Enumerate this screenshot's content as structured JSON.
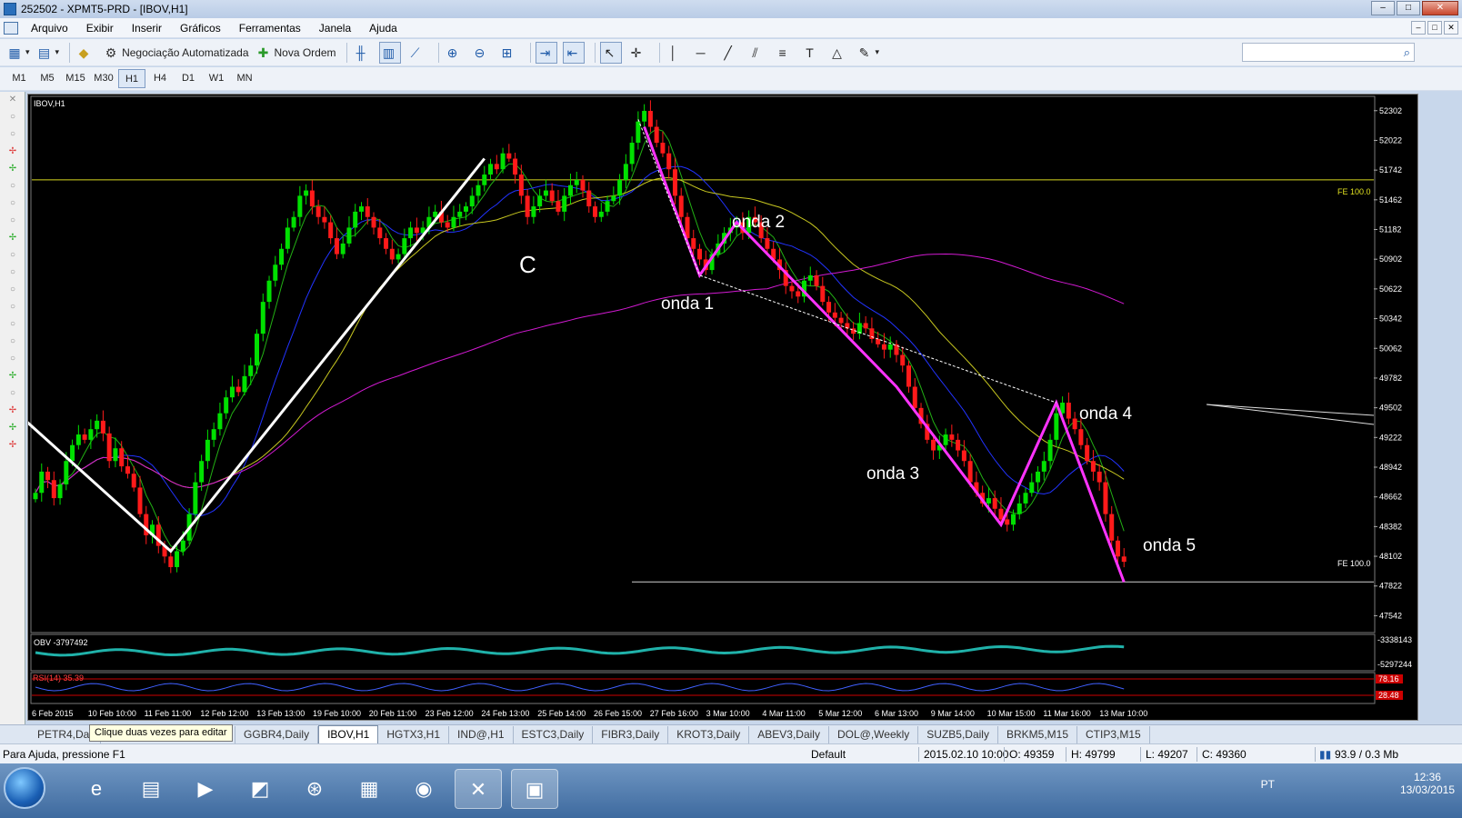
{
  "window": {
    "title": "252502 - XPMT5-PRD - [IBOV,H1]",
    "controls": [
      "–",
      "□",
      "✕"
    ]
  },
  "menu": {
    "items": [
      "Arquivo",
      "Exibir",
      "Inserir",
      "Gráficos",
      "Ferramentas",
      "Janela",
      "Ajuda"
    ]
  },
  "toolbar": {
    "auto_trading_label": "Negociação Automatizada",
    "new_order_label": "Nova Ordem",
    "search_placeholder": ""
  },
  "timeframes": {
    "items": [
      "M1",
      "M5",
      "M15",
      "M30",
      "H1",
      "H4",
      "D1",
      "W1",
      "MN"
    ],
    "active": "H1"
  },
  "chart": {
    "symbol_label": "IBOV,H1",
    "obv_label": "OBV -3797492",
    "rsi_label": "RSI(14) 35.39",
    "fe_label_top": "FE 100.0",
    "fe_label_bottom": "FE 100.0",
    "obv_scale": [
      "-3338143",
      "-5297244"
    ],
    "rsi_scale": [
      "78.16",
      "28.48"
    ],
    "wave_labels": [
      "C",
      "onda 1",
      "onda 2",
      "onda 3",
      "onda 4",
      "onda 5"
    ],
    "colors": {
      "bull": "#00e000",
      "bear": "#ff1a1a",
      "ma_fast": "#22b014",
      "ma_mid": "#2233ff",
      "ma_slow": "#c8c820",
      "ma_long": "#d21ad2",
      "wave_line": "#ff33ff",
      "impulse_line": "#ffffff",
      "obv_line": "#20b2aa"
    }
  },
  "chart_data": {
    "type": "candlestick",
    "title": "IBOV,H1",
    "y_ticks": [
      52302,
      52022,
      51742,
      51462,
      51182,
      50902,
      50622,
      50342,
      50062,
      49782,
      49502,
      49222,
      48942,
      48662,
      48382,
      48102,
      47822,
      47542
    ],
    "x_ticks": [
      "6 Feb 2015",
      "10 Feb 10:00",
      "11 Feb 11:00",
      "12 Feb 12:00",
      "13 Feb 13:00",
      "19 Feb 10:00",
      "20 Feb 11:00",
      "23 Feb 12:00",
      "24 Feb 13:00",
      "25 Feb 14:00",
      "26 Feb 15:00",
      "27 Feb 16:00",
      "3 Mar 10:00",
      "4 Mar 11:00",
      "5 Mar 12:00",
      "6 Mar 13:00",
      "9 Mar 14:00",
      "10 Mar 15:00",
      "11 Mar 16:00",
      "13 Mar 10:00"
    ],
    "ylim": [
      47400,
      52420
    ],
    "fe_levels": [
      51650,
      47860
    ],
    "closes": [
      48700,
      48900,
      48820,
      48650,
      48780,
      49000,
      49150,
      49250,
      49200,
      49300,
      49380,
      49260,
      49000,
      49120,
      48950,
      48880,
      48750,
      48500,
      48300,
      48400,
      48200,
      48100,
      48000,
      48150,
      48250,
      48500,
      48800,
      49000,
      49200,
      49300,
      49450,
      49600,
      49700,
      49650,
      49800,
      49900,
      50200,
      50500,
      50700,
      50850,
      51000,
      51200,
      51300,
      51500,
      51550,
      51400,
      51300,
      51250,
      51100,
      50950,
      51050,
      51200,
      51350,
      51400,
      51300,
      51200,
      51100,
      51000,
      50900,
      50950,
      51100,
      51200,
      51150,
      51200,
      51300,
      51350,
      51250,
      51200,
      51300,
      51350,
      51400,
      51500,
      51600,
      51700,
      51800,
      51750,
      51900,
      51850,
      51700,
      51500,
      51300,
      51400,
      51500,
      51550,
      51450,
      51350,
      51500,
      51600,
      51650,
      51550,
      51400,
      51300,
      51350,
      51450,
      51500,
      51650,
      51800,
      52000,
      52200,
      52300,
      52150,
      52000,
      51900,
      51750,
      51500,
      51300,
      51100,
      51000,
      50900,
      50800,
      50950,
      51050,
      51150,
      51200,
      51250,
      51150,
      51300,
      51250,
      51100,
      51000,
      50900,
      50800,
      50650,
      50600,
      50550,
      50700,
      50750,
      50650,
      50500,
      50400,
      50350,
      50300,
      50250,
      50200,
      50300,
      50250,
      50150,
      50100,
      50050,
      50100,
      50000,
      49900,
      49700,
      49500,
      49350,
      49200,
      49100,
      49150,
      49250,
      49200,
      49100,
      49000,
      48800,
      48700,
      48600,
      48650,
      48550,
      48450,
      48400,
      48500,
      48600,
      48700,
      48800,
      48900,
      49000,
      49200,
      49450,
      49550,
      49400,
      49300,
      49150,
      49000,
      48900,
      48800,
      48500,
      48250,
      48100,
      48050
    ]
  },
  "tabs": {
    "items": [
      "PETR4,Dai",
      "aily",
      "GGBR4,Daily",
      "IBOV,H1",
      "HGTX3,H1",
      "IND@,H1",
      "ESTC3,Daily",
      "FIBR3,Daily",
      "KROT3,Daily",
      "ABEV3,Daily",
      "DOL@,Weekly",
      "SUZB5,Daily",
      "BRKM5,M15",
      "CTIP3,M15"
    ],
    "active": "IBOV,H1",
    "tooltip": "Clique duas vezes para editar"
  },
  "status": {
    "help": "Para Ajuda, pressione F1",
    "profile": "Default",
    "datetime": "2015.02.10 10:00",
    "open": "O: 49359",
    "high": "H: 49799",
    "low": "L: 49207",
    "close": "C: 49360",
    "traffic": "93.9 / 0.3 Mb"
  },
  "taskbar": {
    "lang": "PT",
    "time": "12:36",
    "date": "13/03/2015"
  }
}
